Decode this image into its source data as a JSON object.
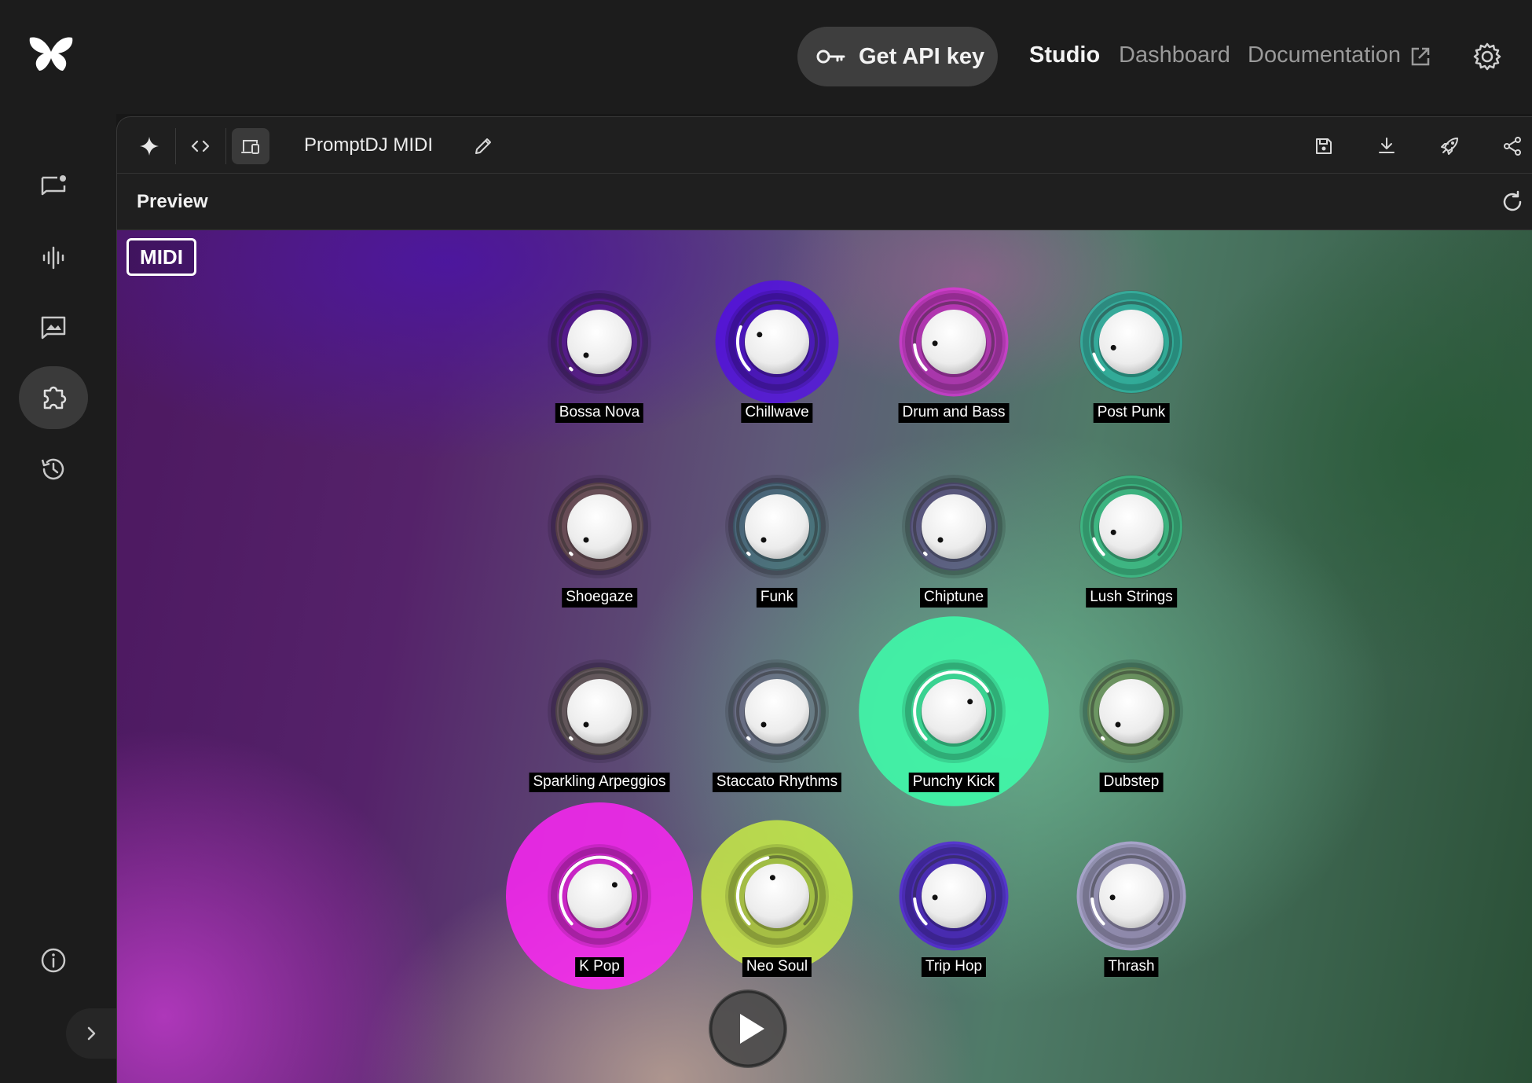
{
  "header": {
    "api_key_label": "Get API key",
    "nav": [
      {
        "label": "Studio",
        "active": true
      },
      {
        "label": "Dashboard",
        "active": false
      },
      {
        "label": "Documentation",
        "active": false
      }
    ]
  },
  "sidebar": {
    "items": [
      {
        "icon": "chat-icon",
        "active": false
      },
      {
        "icon": "audio-waveform-icon",
        "active": false
      },
      {
        "icon": "image-chat-icon",
        "active": false
      },
      {
        "icon": "puzzle-icon",
        "active": true
      },
      {
        "icon": "history-icon",
        "active": false
      }
    ],
    "footer_icons": [
      "info-icon",
      "chevron-right-icon"
    ]
  },
  "toolbar": {
    "app_title": "PromptDJ MIDI",
    "left_icons": [
      "sparkle-icon",
      "code-icon",
      "device-preview-icon",
      "pencil-icon"
    ],
    "right_icons": [
      "save-icon",
      "download-icon",
      "rocket-icon",
      "share-icon"
    ]
  },
  "preview": {
    "label": "Preview",
    "midi_label": "MIDI"
  },
  "colors": {
    "accent_api_button": "#3e3e3e",
    "knob_inactive": "#555555"
  },
  "knobs": [
    {
      "label": "Bossa Nova",
      "weight": 0.0,
      "color": "#9900ff"
    },
    {
      "label": "Chillwave",
      "weight": 0.25,
      "color": "#5200ff"
    },
    {
      "label": "Drum and Bass",
      "weight": 0.15,
      "color": "#ff25f6"
    },
    {
      "label": "Post Punk",
      "weight": 0.1,
      "color": "#2af6de"
    },
    {
      "label": "Shoegaze",
      "weight": 0.0,
      "color": "#ffdd28"
    },
    {
      "label": "Funk",
      "weight": 0.0,
      "color": "#2af6de"
    },
    {
      "label": "Chiptune",
      "weight": 0.0,
      "color": "#9900ff"
    },
    {
      "label": "Lush Strings",
      "weight": 0.1,
      "color": "#3dffab"
    },
    {
      "label": "Sparkling Arpeggios",
      "weight": 0.0,
      "color": "#d8ff3e"
    },
    {
      "label": "Staccato Rhythms",
      "weight": 0.0,
      "color": "#d9b2ff"
    },
    {
      "label": "Punchy Kick",
      "weight": 0.72,
      "color": "#3dffab"
    },
    {
      "label": "Dubstep",
      "weight": 0.0,
      "color": "#ffdd28"
    },
    {
      "label": "K Pop",
      "weight": 0.7,
      "color": "#ff25f6"
    },
    {
      "label": "Neo Soul",
      "weight": 0.45,
      "color": "#d8ff3e"
    },
    {
      "label": "Trip Hop",
      "weight": 0.15,
      "color": "#5200ff"
    },
    {
      "label": "Thrash",
      "weight": 0.15,
      "color": "#d9b2ff"
    }
  ]
}
